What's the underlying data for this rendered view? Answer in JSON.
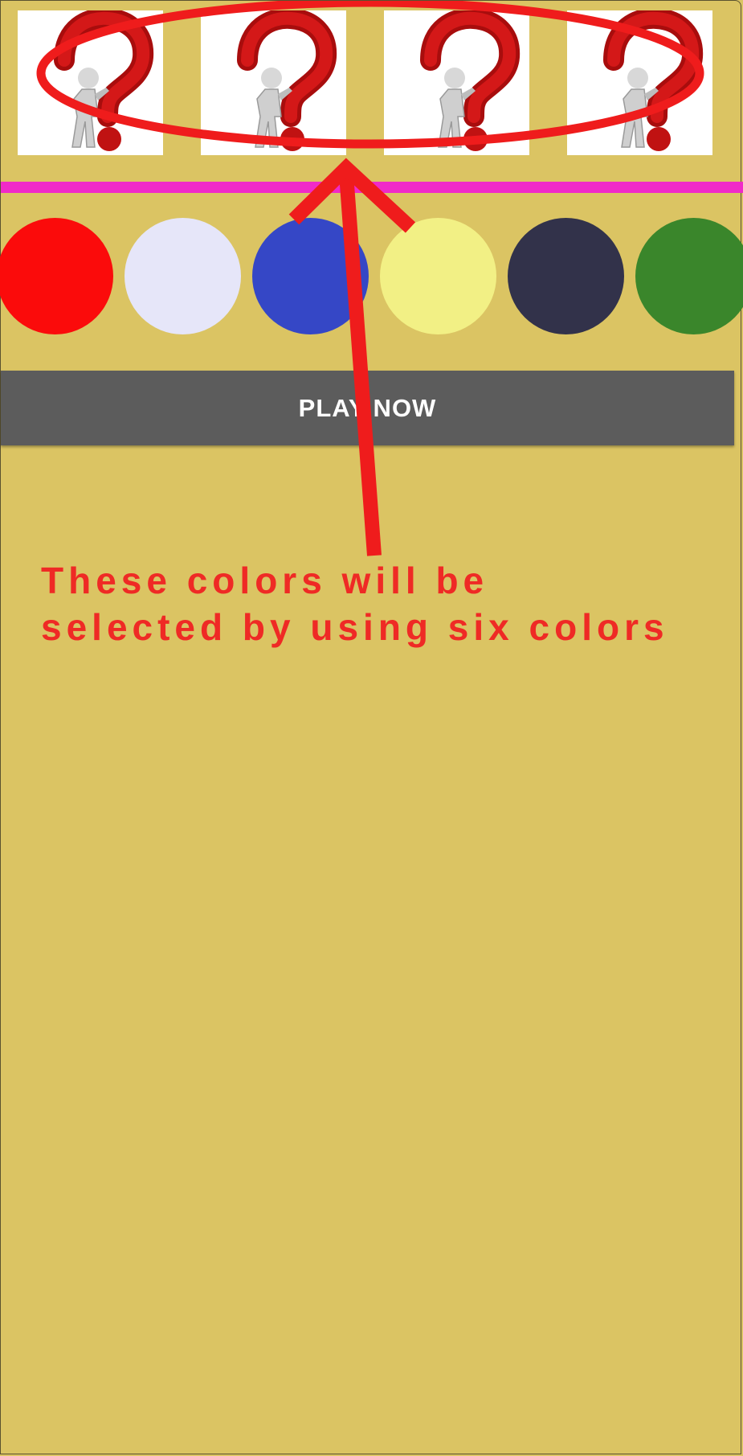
{
  "mystery_row": {
    "slots": [
      {
        "icon": "question-figure-icon"
      },
      {
        "icon": "question-figure-icon"
      },
      {
        "icon": "question-figure-icon"
      },
      {
        "icon": "question-figure-icon"
      }
    ]
  },
  "divider_color": "#f02ac8",
  "palette": {
    "colors": [
      "#fb0b0b",
      "#e6e6f9",
      "#3547c6",
      "#f2f085",
      "#32324a",
      "#3a862b"
    ]
  },
  "play_button": {
    "label": "PLAY NOW"
  },
  "annotation": {
    "line1": "These colors will be",
    "line2": "selected by using six colors",
    "color": "#ef2a25"
  }
}
